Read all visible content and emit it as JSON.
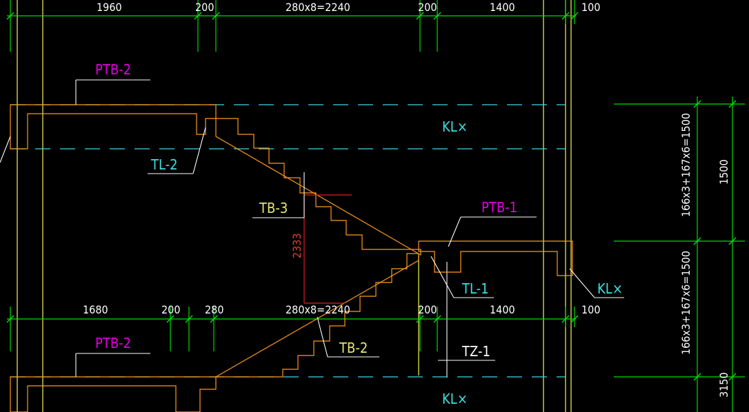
{
  "dimensions": {
    "top_row": [
      "1960",
      "200",
      "280x8=2240",
      "200",
      "1400",
      "100"
    ],
    "mid_row": [
      "1680",
      "200",
      "280",
      "280x8=2240",
      "200",
      "1400",
      "100"
    ],
    "right_col": [
      "166x3+167x6=1500",
      "1500",
      "166x3+167x6=1500",
      "3150"
    ],
    "vertical_red": "2333"
  },
  "labels": {
    "ptb2_top": "PTB-2",
    "ptb2_bottom": "PTB-2",
    "ptb1": "PTB-1",
    "tl2": "TL-2",
    "tl1": "TL-1",
    "tb3": "TB-3",
    "tb2": "TB-2",
    "tz1": "TZ-1",
    "kl_top": "KL×",
    "kl_right": "KL×",
    "kl_bottom": "KL×"
  },
  "colors": {
    "background": "#000000",
    "dimension_lines": "#00e000",
    "structure_outline": "#ff9a1a",
    "beam_dashes": "#40d8e8",
    "column_lines": "#e6e650",
    "label_magenta": "#e000e0",
    "label_cyan": "#40e0e0",
    "label_yellow": "#e8e870"
  }
}
